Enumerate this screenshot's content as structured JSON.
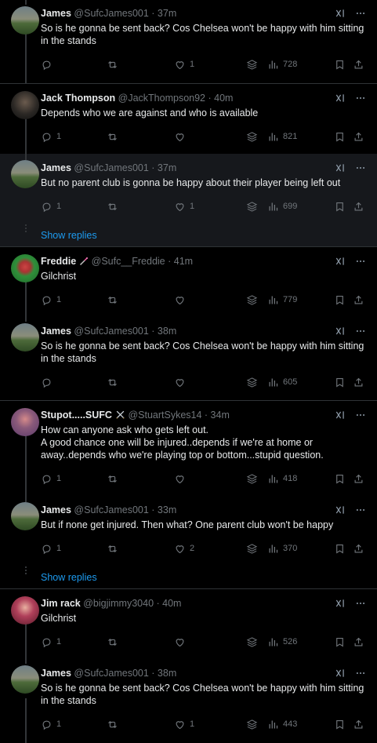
{
  "colors": {
    "background": "#000000",
    "text": "#e7e9ea",
    "muted": "#71767b",
    "link": "#1d9bf0",
    "separator": "#2f3336"
  },
  "tweets": [
    {
      "name": "James",
      "handle": "@SufcJames001",
      "time": "· 37m",
      "lines": [
        "So is he gonna be sent back? Cos Chelsea won't be happy with him sitting",
        "in the stands"
      ],
      "replies": "",
      "retweets": "",
      "likes": "1",
      "views": "728",
      "avatar": "field"
    },
    {
      "name": "Jack Thompson",
      "handle": "@JackThompson92",
      "time": "· 40m",
      "lines": [
        "Depends who we are against and who is available"
      ],
      "replies": "1",
      "retweets": "",
      "likes": "",
      "views": "821",
      "avatar": "dark"
    },
    {
      "name": "James",
      "handle": "@SufcJames001",
      "time": "· 37m",
      "lines": [
        "But no parent club is gonna be happy about their player being left out"
      ],
      "replies": "1",
      "retweets": "",
      "likes": "1",
      "views": "699",
      "avatar": "field"
    },
    {
      "name": "Freddie",
      "handle": "@Sufc__Freddie",
      "time": "· 41m",
      "lines": [
        "Gilchrist"
      ],
      "replies": "1",
      "retweets": "",
      "likes": "",
      "views": "779",
      "avatar": "green"
    },
    {
      "name": "James",
      "handle": "@SufcJames001",
      "time": "· 38m",
      "lines": [
        "So is he gonna be sent back? Cos Chelsea won't be happy with him sitting",
        "in the stands"
      ],
      "replies": "",
      "retweets": "",
      "likes": "",
      "views": "605",
      "avatar": "field"
    },
    {
      "name": "Stupot.....SUFC",
      "handle": "@StuartSykes14",
      "time": "· 34m",
      "lines": [
        "How can anyone ask who gets left out.",
        "A good chance one will be injured..depends if we're at home or",
        "away..depends who we're playing top or bottom...stupid question."
      ],
      "replies": "1",
      "retweets": "",
      "likes": "",
      "views": "418",
      "avatar": "purple"
    },
    {
      "name": "James",
      "handle": "@SufcJames001",
      "time": "· 33m",
      "lines": [
        "But if none get injured. Then what? One parent club won't be happy"
      ],
      "replies": "1",
      "retweets": "",
      "likes": "2",
      "views": "370",
      "avatar": "field"
    },
    {
      "name": "Jim rack",
      "handle": "@bigjimmy3040",
      "time": "· 40m",
      "lines": [
        "Gilchrist"
      ],
      "replies": "1",
      "retweets": "",
      "likes": "",
      "views": "526",
      "avatar": "red"
    },
    {
      "name": "James",
      "handle": "@SufcJames001",
      "time": "· 38m",
      "lines": [
        "So is he gonna be sent back? Cos Chelsea won't be happy with him sitting",
        "in the stands"
      ],
      "replies": "1",
      "retweets": "",
      "likes": "1",
      "views": "443",
      "avatar": "field"
    }
  ],
  "show_replies_label": "Show replies"
}
